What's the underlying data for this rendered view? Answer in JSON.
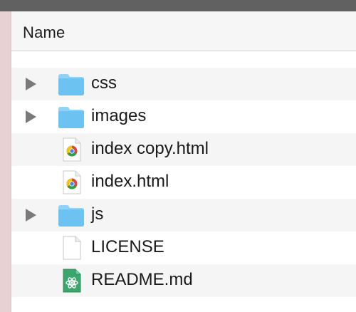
{
  "columns": {
    "name_label": "Name"
  },
  "files": [
    {
      "name": "css",
      "kind": "folder",
      "icon": "folder-icon",
      "expandable": true
    },
    {
      "name": "images",
      "kind": "folder",
      "icon": "folder-icon",
      "expandable": true
    },
    {
      "name": "index copy.html",
      "kind": "html",
      "icon": "chrome-html-file-icon",
      "expandable": false
    },
    {
      "name": "index.html",
      "kind": "html",
      "icon": "chrome-html-file-icon",
      "expandable": false
    },
    {
      "name": "js",
      "kind": "folder",
      "icon": "folder-icon",
      "expandable": true
    },
    {
      "name": "LICENSE",
      "kind": "document",
      "icon": "blank-document-icon",
      "expandable": false
    },
    {
      "name": "README.md",
      "kind": "markdown",
      "icon": "atom-markdown-file-icon",
      "expandable": false
    }
  ],
  "colors": {
    "folder": "#6cc3f2",
    "folder_tab": "#8fd2f6",
    "disclosure": "#7a7a7a",
    "stripe": "#f5f5f5",
    "atom_green": "#3ca76d"
  }
}
